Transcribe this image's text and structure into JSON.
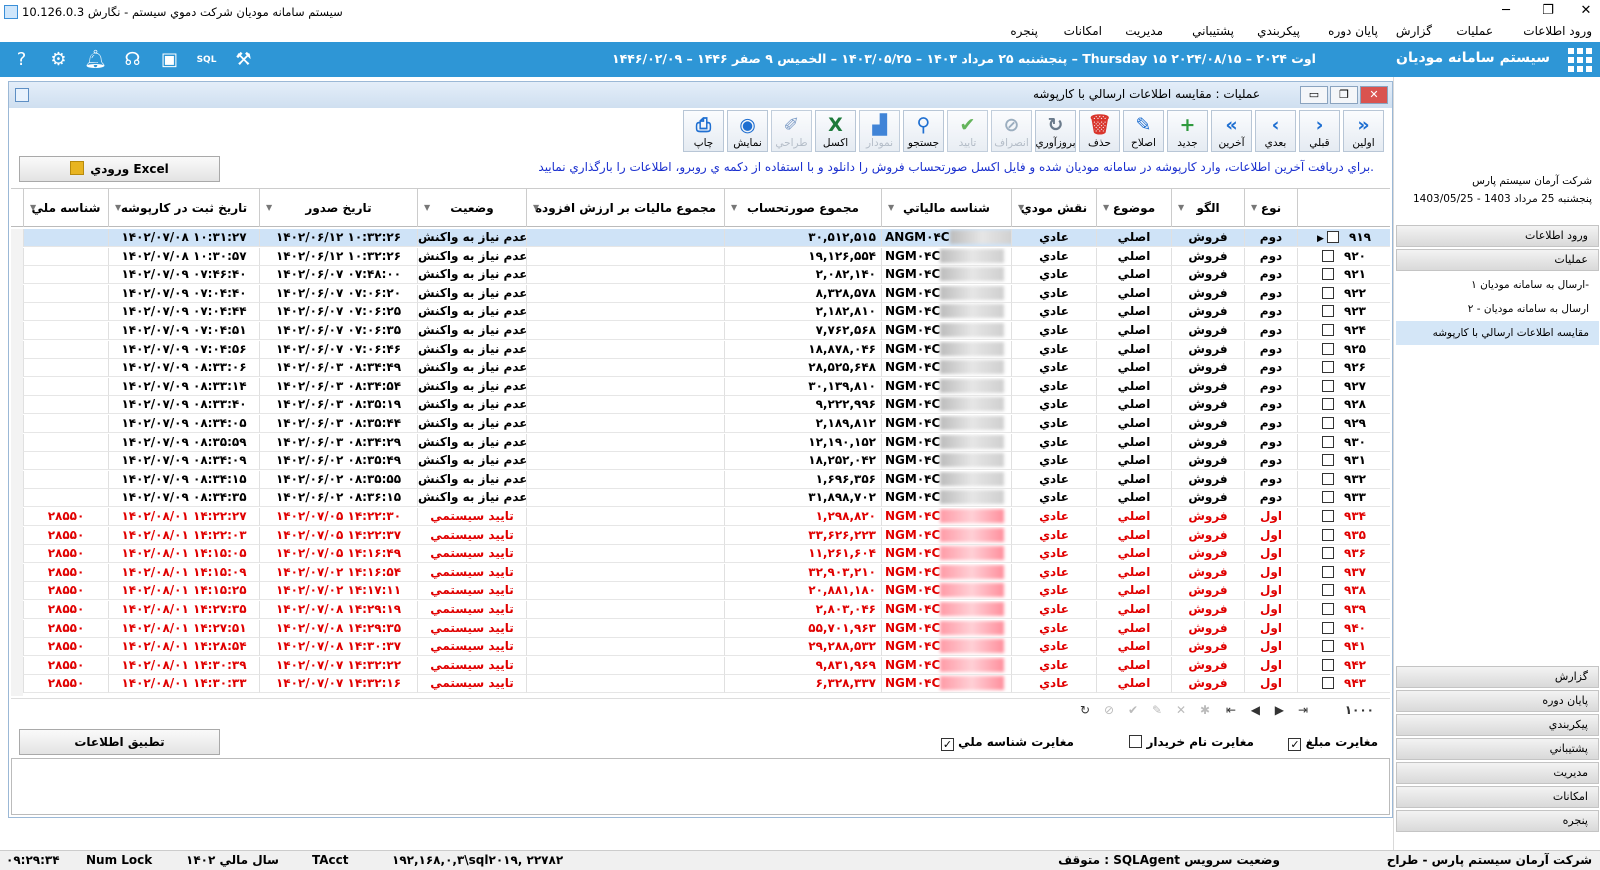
{
  "window": {
    "title": "سيستم سامانه موديان شرکت دموي سيستم - نگارش 10.126.0.3"
  },
  "menu": [
    "ورود اطلاعات",
    "عمليات",
    "گزارش",
    "پايان دوره",
    "پيکربندي",
    "پشتيباني",
    "مديريت",
    "امکانات",
    "پنجره"
  ],
  "header": {
    "system_name": "سيستم سامانه موديان",
    "date_string": "پنجشنبه ۲۵ مرداد ۱۴۰۳ – ۱۴۰۳/۰۵/۲۵ – الخميس ۹ صفر ۱۴۴۶ – ۱۴۴۶/۰۲/۰۹ – Thursday ۱۵ اوت ۲۰۲۴ – ۲۰۲۴/۰۸/۱۵",
    "icons": [
      "help-icon",
      "settings-icon",
      "notification-bell-icon",
      "support-headset-icon",
      "gift-icon",
      "sql-database-icon",
      "tools-icon"
    ]
  },
  "right_panel": {
    "company": "شرکت آرمان سيستم پارس",
    "date": "پنجشنبه 25 مرداد 1403 - 1403/05/25",
    "sections_top": [
      "ورود اطلاعات",
      "عمليات"
    ],
    "sub_items": [
      "ارسال به سامانه موديان ۱-",
      "ارسال به سامانه موديان - ۲",
      "مقايسه اطلاعات ارسالي با کارپوشه"
    ],
    "selected_sub": 2,
    "sections_bottom": [
      "گزارش",
      "پايان دوره",
      "پيکربندي",
      "پشتيباني",
      "مديريت",
      "امکانات",
      "پنجره"
    ]
  },
  "child": {
    "title": "عمليات : مقايسه اطلاعات ارسالي با کارپوشه",
    "toolbar": [
      {
        "label": "اولين",
        "icon": "first-icon",
        "enabled": true
      },
      {
        "label": "قبلي",
        "icon": "previous-icon",
        "enabled": true
      },
      {
        "label": "بعدي",
        "icon": "next-icon",
        "enabled": true
      },
      {
        "label": "آخرين",
        "icon": "last-icon",
        "enabled": true
      },
      {
        "label": "جديد",
        "icon": "add-icon",
        "enabled": true
      },
      {
        "label": "اصلاح",
        "icon": "edit-icon",
        "enabled": true
      },
      {
        "label": "حذف",
        "icon": "delete-icon",
        "enabled": true
      },
      {
        "label": "بروزآوري",
        "icon": "refresh-icon",
        "enabled": true
      },
      {
        "label": "انصراف",
        "icon": "cancel-icon",
        "enabled": false
      },
      {
        "label": "تاييد",
        "icon": "confirm-icon",
        "enabled": false
      },
      {
        "label": "جستجو",
        "icon": "search-icon",
        "enabled": true
      },
      {
        "label": "نمودار",
        "icon": "chart-icon",
        "enabled": false
      },
      {
        "label": "اکسل",
        "icon": "excel-icon",
        "enabled": true
      },
      {
        "label": "طراحي",
        "icon": "design-icon",
        "enabled": false
      },
      {
        "label": "نمايش",
        "icon": "view-icon",
        "enabled": true
      },
      {
        "label": "چاپ",
        "icon": "print-icon",
        "enabled": true
      }
    ],
    "excel_button": "ورودي Excel",
    "note": "براي دريافت آخرين اطلاعات، وارد کارپوشه در سامانه موديان شده و فايل اکسل صورتحساب فروش را دانلود و با استفاده از دکمه ي روبرو، اطلاعات را بارگذاري نماييد.",
    "columns": [
      "",
      "نوع",
      "الگو",
      "موضوع",
      "نقش مودي",
      "شناسه مالياتي",
      "مجموع صورتحساب",
      "مجموع ماليات بر ارزش افزوده",
      "وضعيت",
      "تاريخ صدور",
      "تاريخ ثبت در کارپوشه",
      "شناسه ملي"
    ],
    "rows": [
      {
        "n": "۹۱۹",
        "type": "دوم",
        "pattern": "فروش",
        "subject": "اصلي",
        "role": "عادي",
        "taxid": "A‎NGM۰۴C",
        "total": "۳۰,۵۱۲,۵۱۵",
        "vat": "",
        "status": "عدم نياز به واکنش",
        "issue": "۱۴۰۲/۰۶/۱۲ ۱۰:۳۲:۲۶",
        "reg": "۱۴۰۲/۰۷/۰۸ ۱۰:۳۱:۲۷",
        "nid": "",
        "red": false
      },
      {
        "n": "۹۲۰",
        "type": "دوم",
        "pattern": "فروش",
        "subject": "اصلي",
        "role": "عادي",
        "taxid": "NGM۰۴C",
        "total": "۱۹,۱۲۶,۵۵۴",
        "vat": "",
        "status": "عدم نياز به واکنش",
        "issue": "۱۴۰۲/۰۶/۱۲ ۱۰:۳۲:۲۶",
        "reg": "۱۴۰۲/۰۷/۰۸ ۱۰:۳۰:۵۷",
        "nid": "",
        "red": false
      },
      {
        "n": "۹۲۱",
        "type": "دوم",
        "pattern": "فروش",
        "subject": "اصلي",
        "role": "عادي",
        "taxid": "NGM۰۴C",
        "total": "۲,۰۸۲,۱۴۰",
        "vat": "",
        "status": "عدم نياز به واکنش",
        "issue": "۱۴۰۲/۰۶/۰۷ ۰۷:۴۸:۰۰",
        "reg": "۱۴۰۲/۰۷/۰۹ ۰۷:۴۶:۴۰",
        "nid": "",
        "red": false
      },
      {
        "n": "۹۲۲",
        "type": "دوم",
        "pattern": "فروش",
        "subject": "اصلي",
        "role": "عادي",
        "taxid": "NGM۰۴C",
        "total": "۸,۳۲۸,۵۷۸",
        "vat": "",
        "status": "عدم نياز به واکنش",
        "issue": "۱۴۰۲/۰۶/۰۷ ۰۷:۰۶:۲۰",
        "reg": "۱۴۰۲/۰۷/۰۹ ۰۷:۰۴:۴۰",
        "nid": "",
        "red": false
      },
      {
        "n": "۹۲۳",
        "type": "دوم",
        "pattern": "فروش",
        "subject": "اصلي",
        "role": "عادي",
        "taxid": "NGM۰۴C",
        "total": "۲,۱۸۲,۸۱۰",
        "vat": "",
        "status": "عدم نياز به واکنش",
        "issue": "۱۴۰۲/۰۶/۰۷ ۰۷:۰۶:۲۵",
        "reg": "۱۴۰۲/۰۷/۰۹ ۰۷:۰۴:۴۴",
        "nid": "",
        "red": false
      },
      {
        "n": "۹۲۴",
        "type": "دوم",
        "pattern": "فروش",
        "subject": "اصلي",
        "role": "عادي",
        "taxid": "NGM۰۴C",
        "total": "۷,۷۶۲,۵۶۸",
        "vat": "",
        "status": "عدم نياز به واکنش",
        "issue": "۱۴۰۲/۰۶/۰۷ ۰۷:۰۶:۳۵",
        "reg": "۱۴۰۲/۰۷/۰۹ ۰۷:۰۴:۵۱",
        "nid": "",
        "red": false
      },
      {
        "n": "۹۲۵",
        "type": "دوم",
        "pattern": "فروش",
        "subject": "اصلي",
        "role": "عادي",
        "taxid": "NGM۰۴C",
        "total": "۱۸,۸۷۸,۰۴۶",
        "vat": "",
        "status": "عدم نياز به واکنش",
        "issue": "۱۴۰۲/۰۶/۰۷ ۰۷:۰۶:۴۶",
        "reg": "۱۴۰۲/۰۷/۰۹ ۰۷:۰۴:۵۶",
        "nid": "",
        "red": false
      },
      {
        "n": "۹۲۶",
        "type": "دوم",
        "pattern": "فروش",
        "subject": "اصلي",
        "role": "عادي",
        "taxid": "NGM۰۴C",
        "total": "۲۸,۵۲۵,۶۴۸",
        "vat": "",
        "status": "عدم نياز به واکنش",
        "issue": "۱۴۰۲/۰۶/۰۳ ۰۸:۳۴:۴۹",
        "reg": "۱۴۰۲/۰۷/۰۹ ۰۸:۳۳:۰۶",
        "nid": "",
        "red": false
      },
      {
        "n": "۹۲۷",
        "type": "دوم",
        "pattern": "فروش",
        "subject": "اصلي",
        "role": "عادي",
        "taxid": "NGM۰۴C",
        "total": "۳۰,۱۳۹,۸۱۰",
        "vat": "",
        "status": "عدم نياز به واکنش",
        "issue": "۱۴۰۲/۰۶/۰۳ ۰۸:۳۴:۵۴",
        "reg": "۱۴۰۲/۰۷/۰۹ ۰۸:۳۳:۱۴",
        "nid": "",
        "red": false
      },
      {
        "n": "۹۲۸",
        "type": "دوم",
        "pattern": "فروش",
        "subject": "اصلي",
        "role": "عادي",
        "taxid": "NGM۰۴C",
        "total": "۹,۲۲۲,۹۹۶",
        "vat": "",
        "status": "عدم نياز به واکنش",
        "issue": "۱۴۰۲/۰۶/۰۳ ۰۸:۳۵:۱۹",
        "reg": "۱۴۰۲/۰۷/۰۹ ۰۸:۳۳:۴۰",
        "nid": "",
        "red": false
      },
      {
        "n": "۹۲۹",
        "type": "دوم",
        "pattern": "فروش",
        "subject": "اصلي",
        "role": "عادي",
        "taxid": "NGM۰۴C",
        "total": "۲,۱۸۹,۸۱۲",
        "vat": "",
        "status": "عدم نياز به واکنش",
        "issue": "۱۴۰۲/۰۶/۰۳ ۰۸:۳۵:۴۴",
        "reg": "۱۴۰۲/۰۷/۰۹ ۰۸:۳۴:۰۵",
        "nid": "",
        "red": false
      },
      {
        "n": "۹۳۰",
        "type": "دوم",
        "pattern": "فروش",
        "subject": "اصلي",
        "role": "عادي",
        "taxid": "NGM۰۴C",
        "total": "۱۲,۱۹۰,۱۵۲",
        "vat": "",
        "status": "عدم نياز به واکنش",
        "issue": "۱۴۰۲/۰۶/۰۳ ۰۸:۳۴:۲۹",
        "reg": "۱۴۰۲/۰۷/۰۹ ۰۸:۳۵:۵۹",
        "nid": "",
        "red": false
      },
      {
        "n": "۹۳۱",
        "type": "دوم",
        "pattern": "فروش",
        "subject": "اصلي",
        "role": "عادي",
        "taxid": "NGM۰۴C",
        "total": "۱۸,۲۵۲,۰۴۲",
        "vat": "",
        "status": "عدم نياز به واکنش",
        "issue": "۱۴۰۲/۰۶/۰۲ ۰۸:۳۵:۴۹",
        "reg": "۱۴۰۲/۰۷/۰۹ ۰۸:۳۴:۰۹",
        "nid": "",
        "red": false
      },
      {
        "n": "۹۳۲",
        "type": "دوم",
        "pattern": "فروش",
        "subject": "اصلي",
        "role": "عادي",
        "taxid": "NGM۰۴C",
        "total": "۱,۶۹۶,۳۵۶",
        "vat": "",
        "status": "عدم نياز به واکنش",
        "issue": "۱۴۰۲/۰۶/۰۲ ۰۸:۳۵:۵۵",
        "reg": "۱۴۰۲/۰۷/۰۹ ۰۸:۳۴:۱۵",
        "nid": "",
        "red": false
      },
      {
        "n": "۹۳۳",
        "type": "دوم",
        "pattern": "فروش",
        "subject": "اصلي",
        "role": "عادي",
        "taxid": "NGM۰۴C",
        "total": "۳۱,۸۹۸,۷۰۲",
        "vat": "",
        "status": "عدم نياز به واکنش",
        "issue": "۱۴۰۲/۰۶/۰۲ ۰۸:۳۶:۱۵",
        "reg": "۱۴۰۲/۰۷/۰۹ ۰۸:۳۴:۳۵",
        "nid": "",
        "red": false
      },
      {
        "n": "۹۳۴",
        "type": "اول",
        "pattern": "فروش",
        "subject": "اصلي",
        "role": "عادي",
        "taxid": "NGM۰۴C",
        "total": "۱,۲۹۸,۸۲۰",
        "vat": "",
        "status": "تاييد سيستمي",
        "issue": "۱۴۰۲/۰۷/۰۵ ۱۴:۲۲:۳۰",
        "reg": "۱۴۰۲/۰۸/۰۱ ۱۴:۲۲:۲۷",
        "nid": "۲۸۵۵۰",
        "red": true
      },
      {
        "n": "۹۳۵",
        "type": "اول",
        "pattern": "فروش",
        "subject": "اصلي",
        "role": "عادي",
        "taxid": "NGM۰۴C",
        "total": "۳۳,۶۲۶,۲۲۳",
        "vat": "",
        "status": "تاييد سيستمي",
        "issue": "۱۴۰۲/۰۷/۰۵ ۱۴:۲۲:۳۷",
        "reg": "۱۴۰۲/۰۸/۰۱ ۱۴:۲۲:۰۳",
        "nid": "۲۸۵۵۰",
        "red": true
      },
      {
        "n": "۹۳۶",
        "type": "اول",
        "pattern": "فروش",
        "subject": "اصلي",
        "role": "عادي",
        "taxid": "NGM۰۴C",
        "total": "۱۱,۲۶۱,۶۰۴",
        "vat": "",
        "status": "تاييد سيستمي",
        "issue": "۱۴۰۲/۰۷/۰۵ ۱۴:۱۶:۴۹",
        "reg": "۱۴۰۲/۰۸/۰۱ ۱۴:۱۵:۰۵",
        "nid": "۲۸۵۵۰",
        "red": true
      },
      {
        "n": "۹۳۷",
        "type": "اول",
        "pattern": "فروش",
        "subject": "اصلي",
        "role": "عادي",
        "taxid": "NGM۰۴C",
        "total": "۳۲,۹۰۳,۲۱۰",
        "vat": "",
        "status": "تاييد سيستمي",
        "issue": "۱۴۰۲/۰۷/۰۲ ۱۴:۱۶:۵۴",
        "reg": "۱۴۰۲/۰۸/۰۱ ۱۴:۱۵:۰۹",
        "nid": "۲۸۵۵۰",
        "red": true
      },
      {
        "n": "۹۳۸",
        "type": "اول",
        "pattern": "فروش",
        "subject": "اصلي",
        "role": "عادي",
        "taxid": "NGM۰۴C",
        "total": "۲۰,۸۸۱,۱۸۰",
        "vat": "",
        "status": "تاييد سيستمي",
        "issue": "۱۴۰۲/۰۷/۰۲ ۱۴:۱۷:۱۱",
        "reg": "۱۴۰۲/۰۸/۰۱ ۱۴:۱۵:۲۵",
        "nid": "۲۸۵۵۰",
        "red": true
      },
      {
        "n": "۹۳۹",
        "type": "اول",
        "pattern": "فروش",
        "subject": "اصلي",
        "role": "عادي",
        "taxid": "NGM۰۴C",
        "total": "۲,۸۰۳,۰۴۶",
        "vat": "",
        "status": "تاييد سيستمي",
        "issue": "۱۴۰۲/۰۷/۰۸ ۱۴:۲۹:۱۹",
        "reg": "۱۴۰۲/۰۸/۰۱ ۱۴:۲۷:۳۵",
        "nid": "۲۸۵۵۰",
        "red": true
      },
      {
        "n": "۹۴۰",
        "type": "اول",
        "pattern": "فروش",
        "subject": "اصلي",
        "role": "عادي",
        "taxid": "NGM۰۴C",
        "total": "۵۵,۷۰۱,۹۶۳",
        "vat": "",
        "status": "تاييد سيستمي",
        "issue": "۱۴۰۲/۰۷/۰۸ ۱۴:۲۹:۳۵",
        "reg": "۱۴۰۲/۰۸/۰۱ ۱۴:۲۷:۵۱",
        "nid": "۲۸۵۵۰",
        "red": true
      },
      {
        "n": "۹۴۱",
        "type": "اول",
        "pattern": "فروش",
        "subject": "اصلي",
        "role": "عادي",
        "taxid": "NGM۰۴C",
        "total": "۲۹,۲۸۸,۵۳۲",
        "vat": "",
        "status": "تاييد سيستمي",
        "issue": "۱۴۰۲/۰۷/۰۸ ۱۴:۳۰:۳۷",
        "reg": "۱۴۰۲/۰۸/۰۱ ۱۴:۲۸:۵۴",
        "nid": "۲۸۵۵۰",
        "red": true
      },
      {
        "n": "۹۴۲",
        "type": "اول",
        "pattern": "فروش",
        "subject": "اصلي",
        "role": "عادي",
        "taxid": "NGM۰۴C",
        "total": "۹,۸۳۱,۹۶۹",
        "vat": "",
        "status": "تاييد سيستمي",
        "issue": "۱۴۰۲/۰۷/۰۷ ۱۴:۳۲:۲۲",
        "reg": "۱۴۰۲/۰۸/۰۱ ۱۴:۳۰:۳۹",
        "nid": "۲۸۵۵۰",
        "red": true
      },
      {
        "n": "۹۴۳",
        "type": "اول",
        "pattern": "فروش",
        "subject": "اصلي",
        "role": "عادي",
        "taxid": "NGM۰۴C",
        "total": "۶,۳۲۸,۳۳۷",
        "vat": "",
        "status": "تاييد سيستمي",
        "issue": "۱۴۰۲/۰۷/۰۷ ۱۴:۳۲:۱۶",
        "reg": "۱۴۰۲/۰۸/۰۱ ۱۴:۳۰:۳۳",
        "nid": "۲۸۵۵۰",
        "red": true
      }
    ],
    "record_count": "۱۰۰۰",
    "apply_button": "تطبيق اطلاعات",
    "checks": [
      {
        "label": "مغايرت مبلغ",
        "checked": true
      },
      {
        "label": "مغايرت نام خريدار",
        "checked": false
      },
      {
        "label": "مغايرت شناسه ملي",
        "checked": true
      }
    ]
  },
  "status": {
    "company": "شرکت آرمان سيستم پارس - طراح",
    "agent": "متوقف : SQLAgent وضعيت سرويس",
    "server": "۱۹۲,۱۶۸,۰,۳\\sql۲۰۱۹, ۲۲۷۸۲",
    "user": "TAcct",
    "fiscal": "سال مالي ۱۴۰۲",
    "numlock": "Num Lock",
    "time": "۰۹:۲۹:۳۴"
  }
}
